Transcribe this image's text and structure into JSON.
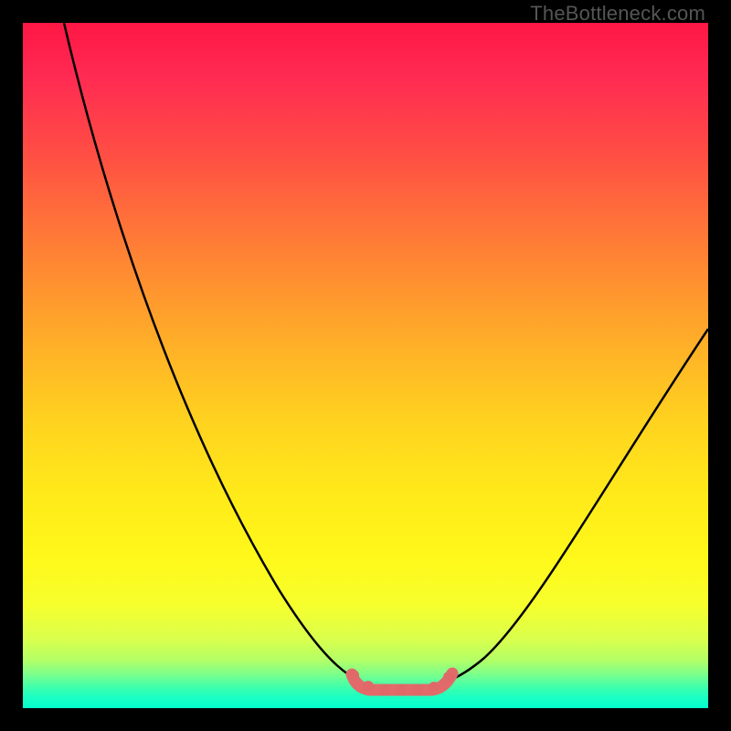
{
  "watermark": "TheBottleneck.com",
  "colors": {
    "background": "#000000",
    "gradient_top": "#ff1744",
    "gradient_mid": "#ffd21f",
    "gradient_bottom": "#05ffcf",
    "curve": "#000000",
    "valley_marker": "#e26a6a"
  },
  "chart_data": {
    "type": "line",
    "title": "",
    "xlabel": "",
    "ylabel": "",
    "xlim": [
      0,
      100
    ],
    "ylim": [
      0,
      100
    ],
    "grid": false,
    "legend": false,
    "series": [
      {
        "name": "bottleneck-curve",
        "x": [
          6,
          12,
          20,
          28,
          37,
          45,
          50,
          54,
          58,
          63,
          68,
          76,
          86,
          100
        ],
        "values": [
          100,
          78,
          58,
          40,
          22,
          10,
          4,
          2.5,
          2.5,
          5,
          12,
          25,
          42,
          55
        ]
      }
    ],
    "annotations": [
      {
        "name": "optimal-range",
        "x_range": [
          48,
          62
        ],
        "y_approx": 2.5,
        "style": "thick-salmon-beaded"
      }
    ],
    "background_gradient": {
      "direction": "vertical",
      "stops": [
        {
          "pos": 0.0,
          "color": "#ff1744"
        },
        {
          "pos": 0.5,
          "color": "#ffd21f"
        },
        {
          "pos": 0.9,
          "color": "#d9ff4d"
        },
        {
          "pos": 1.0,
          "color": "#05ffcf"
        }
      ]
    }
  }
}
